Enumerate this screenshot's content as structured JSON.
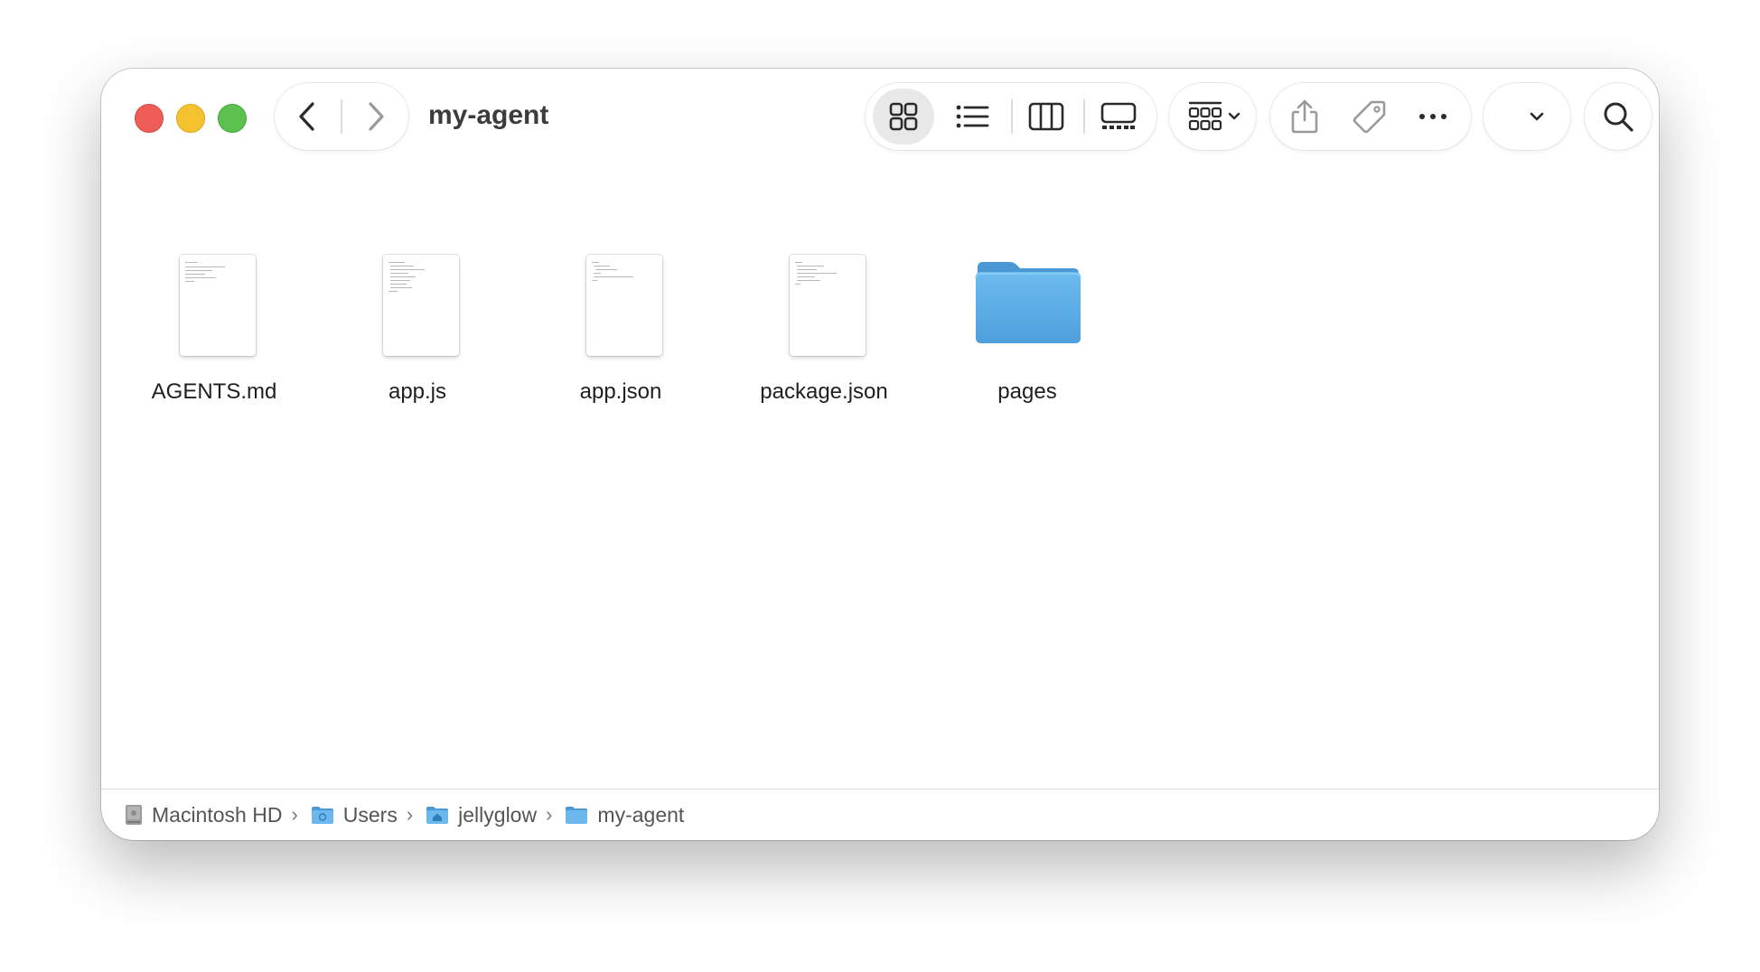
{
  "window": {
    "title": "my-agent"
  },
  "toolbar": {
    "back_icon": "chevron-left-icon",
    "forward_icon": "chevron-right-icon",
    "views": [
      {
        "name": "icon-view",
        "icon": "grid-icon",
        "selected": true
      },
      {
        "name": "list-view",
        "icon": "list-icon",
        "selected": false
      },
      {
        "name": "column-view",
        "icon": "columns-icon",
        "selected": false
      },
      {
        "name": "gallery-view",
        "icon": "gallery-icon",
        "selected": false
      }
    ],
    "group_icon": "group-by-icon",
    "share_icon": "share-icon",
    "tag_icon": "tag-icon",
    "more_icon": "ellipsis-icon",
    "search_icon": "search-icon"
  },
  "files": [
    {
      "name": "AGENTS.md",
      "kind": "document"
    },
    {
      "name": "app.js",
      "kind": "document"
    },
    {
      "name": "app.json",
      "kind": "document"
    },
    {
      "name": "package.json",
      "kind": "document"
    },
    {
      "name": "pages",
      "kind": "folder"
    }
  ],
  "pathbar": {
    "items": [
      {
        "label": "Macintosh HD",
        "icon": "hard-drive-icon"
      },
      {
        "label": "Users",
        "icon": "folder-icon"
      },
      {
        "label": "jellyglow",
        "icon": "home-folder-icon"
      },
      {
        "label": "my-agent",
        "icon": "folder-icon"
      }
    ]
  },
  "colors": {
    "close": "#ee5d57",
    "minimize": "#f5c22f",
    "zoom": "#5cc14f",
    "folder": "#5aaee8",
    "selected_view_bg": "#e8e8e8"
  }
}
